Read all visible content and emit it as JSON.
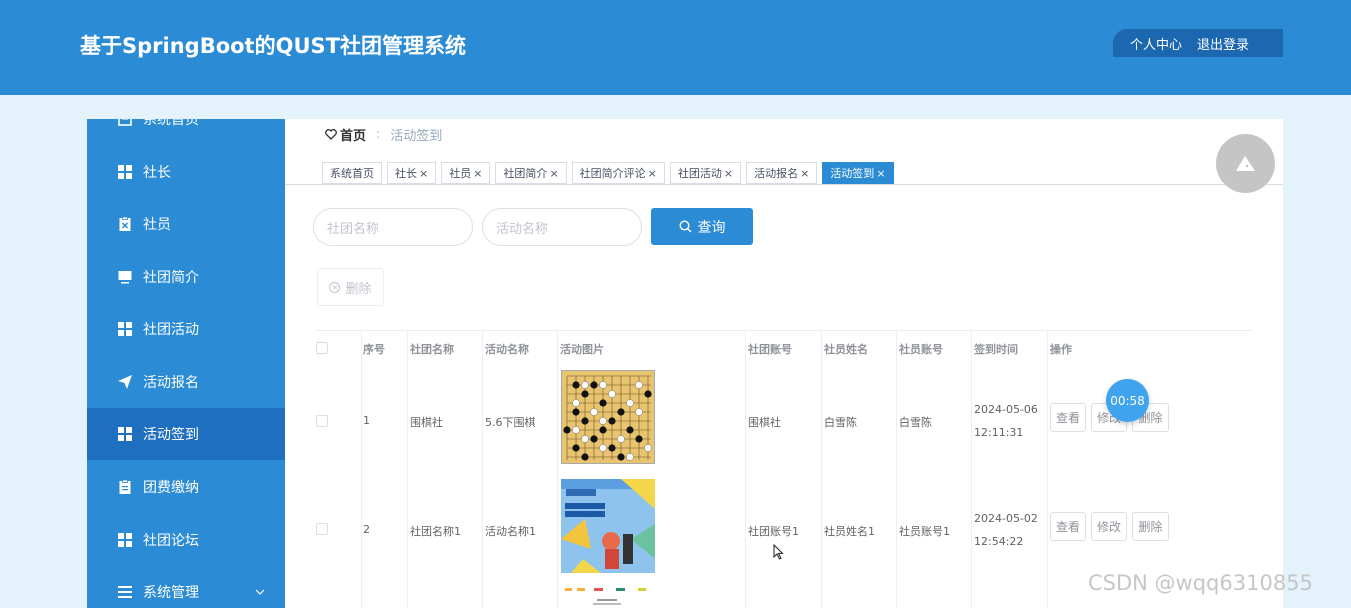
{
  "header": {
    "title": "基于SpringBoot的QUST社团管理系统",
    "user_center": "个人中心",
    "logout": "退出登录"
  },
  "sidebar": {
    "items": [
      {
        "label": "系统首页",
        "icon": "home-icon"
      },
      {
        "label": "社长",
        "icon": "grid-icon"
      },
      {
        "label": "社员",
        "icon": "clipboard-x-icon"
      },
      {
        "label": "社团简介",
        "icon": "monitor-icon"
      },
      {
        "label": "社团活动",
        "icon": "grid-icon"
      },
      {
        "label": "活动报名",
        "icon": "send-icon"
      },
      {
        "label": "活动签到",
        "icon": "grid-icon",
        "active": true
      },
      {
        "label": "团费缴纳",
        "icon": "clipboard-icon"
      },
      {
        "label": "社团论坛",
        "icon": "grid-icon"
      },
      {
        "label": "系统管理",
        "icon": "menu-icon",
        "expandable": true
      }
    ]
  },
  "breadcrumb": {
    "home": "首页",
    "separator": ":",
    "current": "活动签到"
  },
  "tabs": [
    {
      "label": "系统首页",
      "closable": false
    },
    {
      "label": "社长",
      "closable": true
    },
    {
      "label": "社员",
      "closable": true
    },
    {
      "label": "社团简介",
      "closable": true
    },
    {
      "label": "社团简介评论",
      "closable": true
    },
    {
      "label": "社团活动",
      "closable": true
    },
    {
      "label": "活动报名",
      "closable": true
    },
    {
      "label": "活动签到",
      "closable": true,
      "active": true
    }
  ],
  "tab_close_glyph": "×",
  "search": {
    "club_placeholder": "社团名称",
    "activity_placeholder": "活动名称",
    "query_label": "查询"
  },
  "delete_label": "删除",
  "table": {
    "headers": [
      "序号",
      "社团名称",
      "活动名称",
      "活动图片",
      "社团账号",
      "社员姓名",
      "社员账号",
      "签到时间",
      "操作"
    ],
    "rows": [
      {
        "index": "1",
        "club": "围棋社",
        "activity": "5.6下围棋",
        "club_account": "围棋社",
        "member_name": "白雪陈",
        "member_account": "白雪陈",
        "date": "2024-05-06",
        "time": "12:11:31"
      },
      {
        "index": "2",
        "club": "社团名称1",
        "activity": "活动名称1",
        "club_account": "社团账号1",
        "member_name": "社员姓名1",
        "member_account": "社员账号1",
        "date": "2024-05-02",
        "time": "12:54:22"
      }
    ],
    "actions": {
      "view": "查看",
      "edit": "修改",
      "delete": "删除"
    }
  },
  "timer": "00:58",
  "watermark": "CSDN @wqq6310855",
  "colors": {
    "primary": "#2b8bd4",
    "active_menu": "#1f6fc0",
    "header_action_bg": "#1b68b0"
  }
}
